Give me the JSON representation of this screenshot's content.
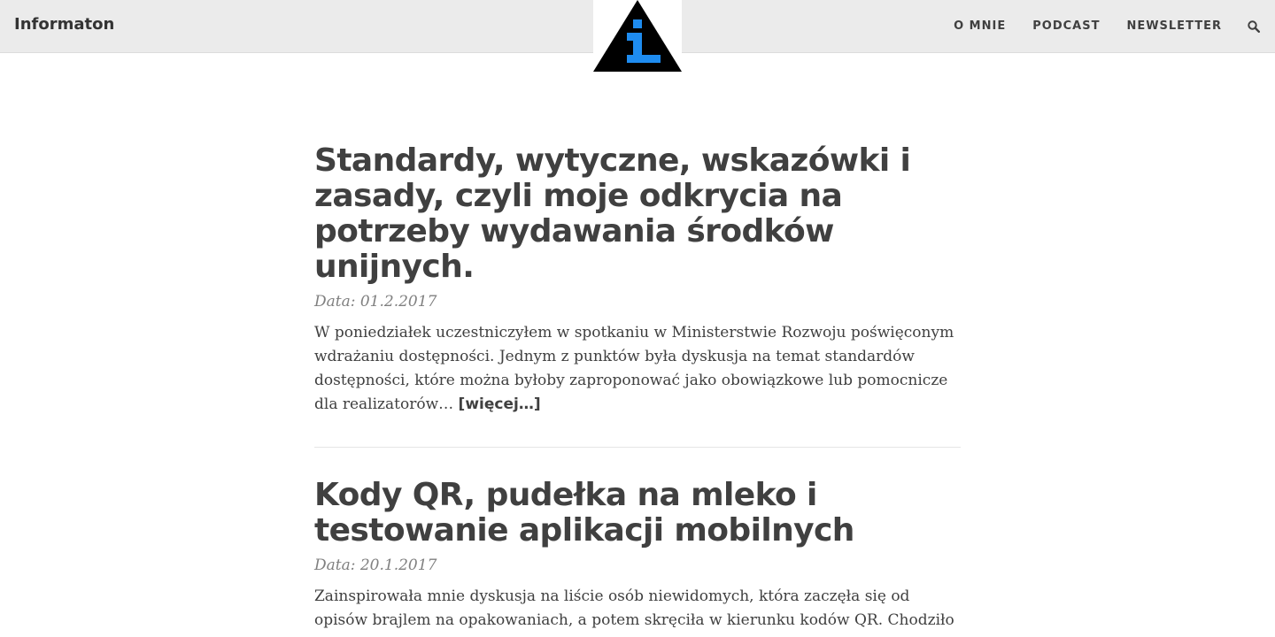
{
  "site": {
    "brand": "Informaton",
    "logo_letter": "i"
  },
  "nav": {
    "items": [
      {
        "label": "O MNIE"
      },
      {
        "label": "PODCAST"
      },
      {
        "label": "NEWSLETTER"
      }
    ],
    "search_icon": "search-icon"
  },
  "colors": {
    "navbar_bg": "#ebebeb",
    "logo_triangle": "#000000",
    "logo_accent": "#1e8cf0",
    "text": "#404040",
    "meta": "#808080"
  },
  "posts": [
    {
      "title": "Standardy, wytyczne, wskazówki i zasady, czyli moje odkrycia na potrzeby wydawania środków unijnych.",
      "date": "Data: 01.2.2017",
      "excerpt": "W poniedziałek uczestniczyłem w spotkaniu w Ministerstwie Rozwoju poświęconym wdrażaniu dostępności. Jednym z punktów była dyskusja na temat standardów dostępności, które można byłoby zaproponować jako obowiązkowe lub pomocnicze dla realizatorów…",
      "more": "[więcej…]"
    },
    {
      "title": "Kody QR, pudełka na mleko i testowanie aplikacji mobilnych",
      "date": "Data: 20.1.2017",
      "excerpt": "Zainspirowała mnie dyskusja na liście osób niewidomych, która zaczęła się od opisów brajlem na opakowaniach, a potem skręciła w kierunku kodów QR. Chodziło o to, czy"
    }
  ]
}
